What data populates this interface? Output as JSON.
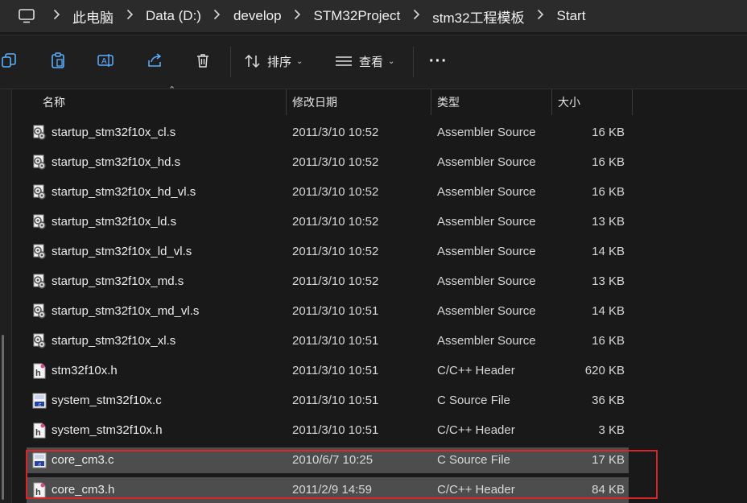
{
  "breadcrumb": [
    "此电脑",
    "Data (D:)",
    "develop",
    "STM32Project",
    "stm32工程模板",
    "Start"
  ],
  "toolbar": {
    "icons": [
      "copy-icon",
      "paste-icon",
      "rename-icon",
      "share-icon",
      "delete-icon"
    ],
    "sort_label": "排序",
    "view_label": "查看",
    "more_label": "···"
  },
  "columns": {
    "name": "名称",
    "date": "修改日期",
    "type": "类型",
    "size": "大小"
  },
  "files": [
    {
      "name": "startup_stm32f10x_cl.s",
      "date": "2011/3/10 10:52",
      "type": "Assembler Source",
      "size": "16 KB",
      "icon": "assembler-file-icon",
      "selected": false
    },
    {
      "name": "startup_stm32f10x_hd.s",
      "date": "2011/3/10 10:52",
      "type": "Assembler Source",
      "size": "16 KB",
      "icon": "assembler-file-icon",
      "selected": false
    },
    {
      "name": "startup_stm32f10x_hd_vl.s",
      "date": "2011/3/10 10:52",
      "type": "Assembler Source",
      "size": "16 KB",
      "icon": "assembler-file-icon",
      "selected": false
    },
    {
      "name": "startup_stm32f10x_ld.s",
      "date": "2011/3/10 10:52",
      "type": "Assembler Source",
      "size": "13 KB",
      "icon": "assembler-file-icon",
      "selected": false
    },
    {
      "name": "startup_stm32f10x_ld_vl.s",
      "date": "2011/3/10 10:52",
      "type": "Assembler Source",
      "size": "14 KB",
      "icon": "assembler-file-icon",
      "selected": false
    },
    {
      "name": "startup_stm32f10x_md.s",
      "date": "2011/3/10 10:52",
      "type": "Assembler Source",
      "size": "13 KB",
      "icon": "assembler-file-icon",
      "selected": false
    },
    {
      "name": "startup_stm32f10x_md_vl.s",
      "date": "2011/3/10 10:51",
      "type": "Assembler Source",
      "size": "14 KB",
      "icon": "assembler-file-icon",
      "selected": false
    },
    {
      "name": "startup_stm32f10x_xl.s",
      "date": "2011/3/10 10:51",
      "type": "Assembler Source",
      "size": "16 KB",
      "icon": "assembler-file-icon",
      "selected": false
    },
    {
      "name": "stm32f10x.h",
      "date": "2011/3/10 10:51",
      "type": "C/C++ Header",
      "size": "620 KB",
      "icon": "header-file-icon",
      "selected": false
    },
    {
      "name": "system_stm32f10x.c",
      "date": "2011/3/10 10:51",
      "type": "C Source File",
      "size": "36 KB",
      "icon": "c-source-file-icon",
      "selected": false
    },
    {
      "name": "system_stm32f10x.h",
      "date": "2011/3/10 10:51",
      "type": "C/C++ Header",
      "size": "3 KB",
      "icon": "header-file-icon",
      "selected": false
    },
    {
      "name": "core_cm3.c",
      "date": "2010/6/7 10:25",
      "type": "C Source File",
      "size": "17 KB",
      "icon": "c-source-file-icon",
      "selected": true
    },
    {
      "name": "core_cm3.h",
      "date": "2011/2/9 14:59",
      "type": "C/C++ Header",
      "size": "84 KB",
      "icon": "header-file-icon",
      "selected": true
    }
  ],
  "colors": {
    "highlight_box": "#d6262b",
    "selected_row": "#4d4d4d",
    "background": "#191919"
  }
}
